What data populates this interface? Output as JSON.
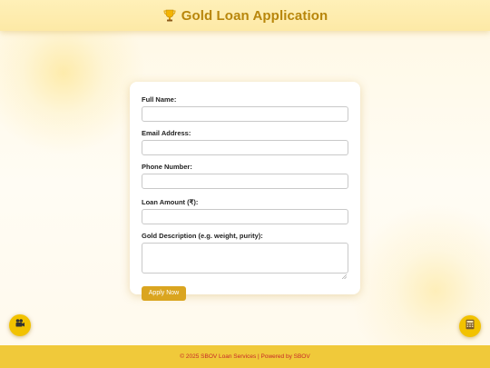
{
  "header": {
    "title": "Gold Loan Application",
    "icon": "trophy-icon"
  },
  "form": {
    "fields": [
      {
        "label": "Full Name:",
        "value": ""
      },
      {
        "label": "Email Address:",
        "value": ""
      },
      {
        "label": "Phone Number:",
        "value": ""
      },
      {
        "label": "Loan Amount (₹):",
        "value": ""
      },
      {
        "label": "Gold Description (e.g. weight, purity):",
        "value": ""
      }
    ],
    "submit_label": "Apply Now"
  },
  "floating_buttons": {
    "left_icon": "video-camera-icon",
    "right_icon": "calculator-icon"
  },
  "footer": {
    "text": "© 2025 SBOV Loan Services | Powered by SBOV"
  },
  "colors": {
    "accent": "#daa520",
    "title": "#b8860b",
    "footer_bg": "#f0c93a",
    "footer_text": "#c62828",
    "fab": "#f2c200"
  }
}
